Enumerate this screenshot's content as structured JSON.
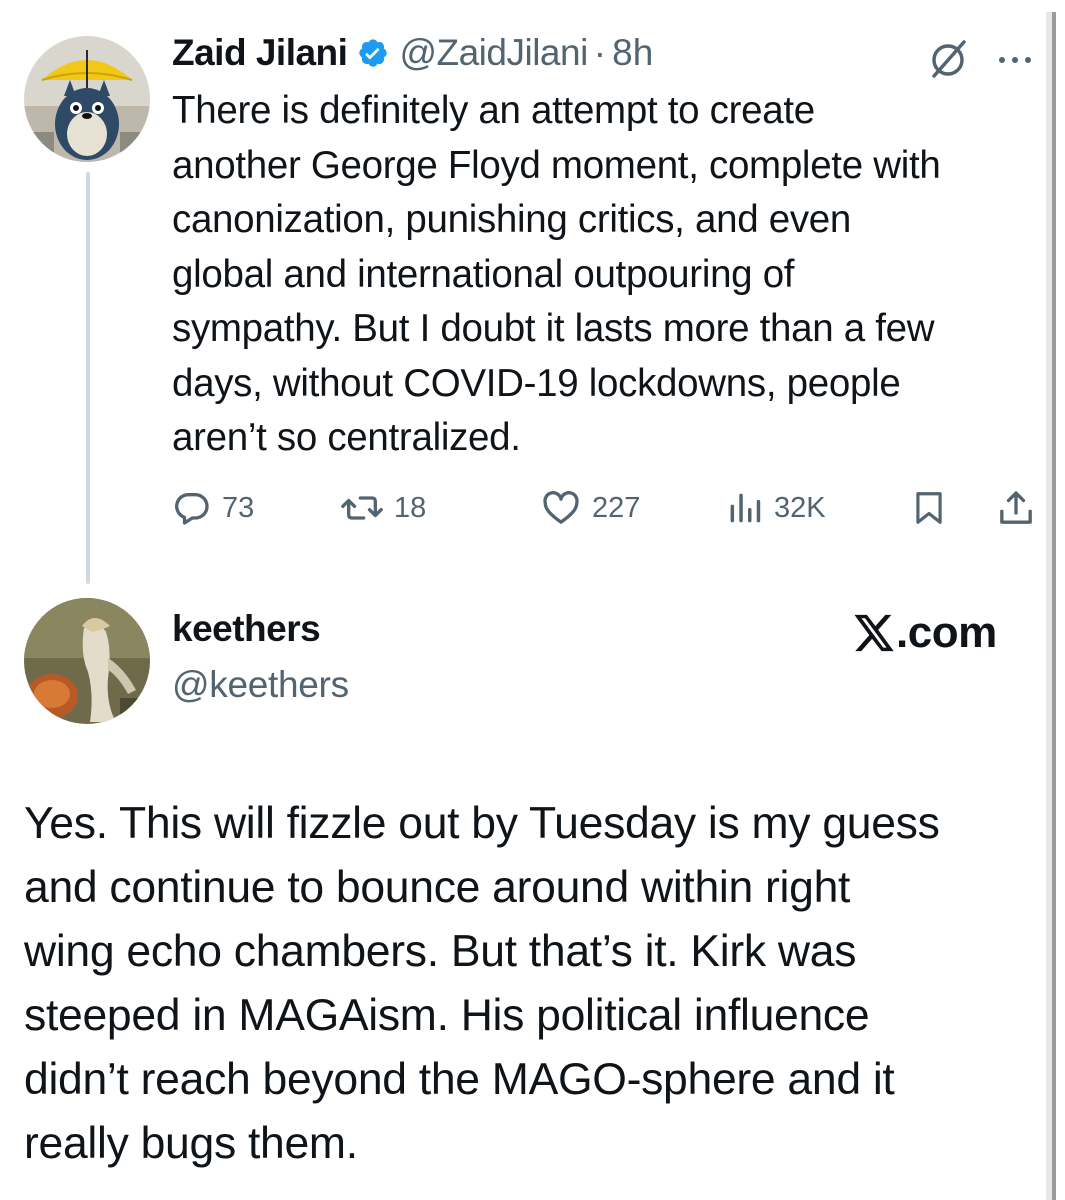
{
  "tweet": {
    "author": {
      "name": "Zaid Jilani",
      "handle": "@ZaidJilani",
      "verified": true,
      "avatar": "umbrella-cartoon-avatar"
    },
    "separator": "·",
    "time": "8h",
    "text_lines": [
      "There is definitely an attempt to create",
      "another George Floyd moment, complete with",
      "canonization, punishing critics, and even",
      "global and international outpouring of",
      "sympathy. But I doubt it lasts more than a few",
      "days, without COVID-19 lockdowns, people",
      "aren’t so centralized."
    ],
    "stats": {
      "replies": "73",
      "reposts": "18",
      "likes": "227",
      "views": "32K"
    },
    "icons": {
      "header": [
        "grok-icon",
        "more-icon"
      ],
      "actions": [
        "reply-icon",
        "repost-icon",
        "like-icon",
        "views-icon",
        "bookmark-icon",
        "share-icon"
      ]
    }
  },
  "reply": {
    "author": {
      "name": "keethers",
      "handle": "@keethers",
      "avatar": "painting-avatar"
    },
    "site_logo": {
      "icon": "x-logo-icon",
      "text": ".com"
    },
    "text_lines": [
      "Yes. This will fizzle out by Tuesday is my guess",
      "and continue to bounce around within right",
      "wing echo chambers. But that’s it. Kirk was",
      "steeped in MAGAism. His political influence",
      "didn’t reach beyond the MAGO-sphere and it",
      "really bugs them."
    ]
  },
  "colors": {
    "text_primary": "#0f1419",
    "text_secondary": "#536471",
    "verified_blue": "#1d9bf0",
    "thread_line": "#cfd9de"
  }
}
